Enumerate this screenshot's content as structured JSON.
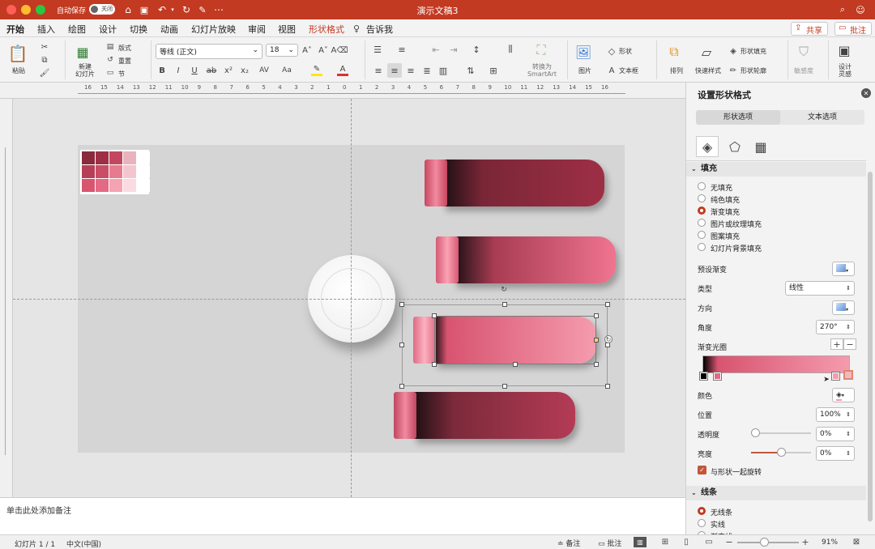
{
  "window": {
    "title": "演示文稿3",
    "autosave_label": "自动保存",
    "autosave_state": "关闭"
  },
  "tabs": [
    "开始",
    "插入",
    "绘图",
    "设计",
    "切换",
    "动画",
    "幻灯片放映",
    "审阅",
    "视图",
    "形状格式"
  ],
  "tell_me": "告诉我",
  "share_label": "共享",
  "comment_label": "批注",
  "ribbon": {
    "paste": "粘贴",
    "new_slide": "新建\n幻灯片",
    "layout": "版式",
    "reset": "重置",
    "section": "节",
    "font_name": "等线 (正文)",
    "font_size": "18",
    "convert_smartart": "转换为\nSmartArt",
    "picture": "图片",
    "shape": "形状",
    "textbox": "文本框",
    "arrange": "排列",
    "quick_styles": "快速样式",
    "shape_fill": "形状填充",
    "shape_outline": "形状轮廓",
    "sensitivity": "敏感度",
    "design_ideas": "设计\n灵感"
  },
  "ruler_numbers": [
    "16",
    "15",
    "14",
    "13",
    "12",
    "11",
    "10",
    "9",
    "8",
    "7",
    "6",
    "5",
    "4",
    "3",
    "2",
    "1",
    "0",
    "1",
    "2",
    "3",
    "4",
    "5",
    "6",
    "7",
    "8",
    "9",
    "10",
    "11",
    "12",
    "13",
    "14",
    "15",
    "16"
  ],
  "notes_placeholder": "单击此处添加备注",
  "status": {
    "slide": "幻灯片 1 / 1",
    "language": "中文(中国)",
    "notes": "备注",
    "comments": "批注",
    "zoom": "91%"
  },
  "pane": {
    "title": "设置形状格式",
    "tab_shape": "形状选项",
    "tab_text": "文本选项",
    "fill_header": "填充",
    "fill_options": [
      "无填充",
      "纯色填充",
      "渐变填充",
      "图片或纹理填充",
      "图案填充",
      "幻灯片背景填充"
    ],
    "preset_gradient": "预设渐变",
    "type_label": "类型",
    "type_value": "线性",
    "direction_label": "方向",
    "angle_label": "角度",
    "angle_value": "270°",
    "stops_label": "渐变光圈",
    "color_label": "颜色",
    "position_label": "位置",
    "position_value": "100%",
    "transparency_label": "透明度",
    "transparency_value": "0%",
    "brightness_label": "亮度",
    "brightness_value": "0%",
    "rotate_label": "与形状一起旋转",
    "line_header": "线条",
    "line_options": [
      "无线条",
      "实线",
      "渐变线"
    ]
  },
  "colors": {
    "accent": "#c23a22",
    "pink_dark": "#9e2f45",
    "pink_mid": "#e05a75",
    "pink_light": "#f07f95"
  }
}
